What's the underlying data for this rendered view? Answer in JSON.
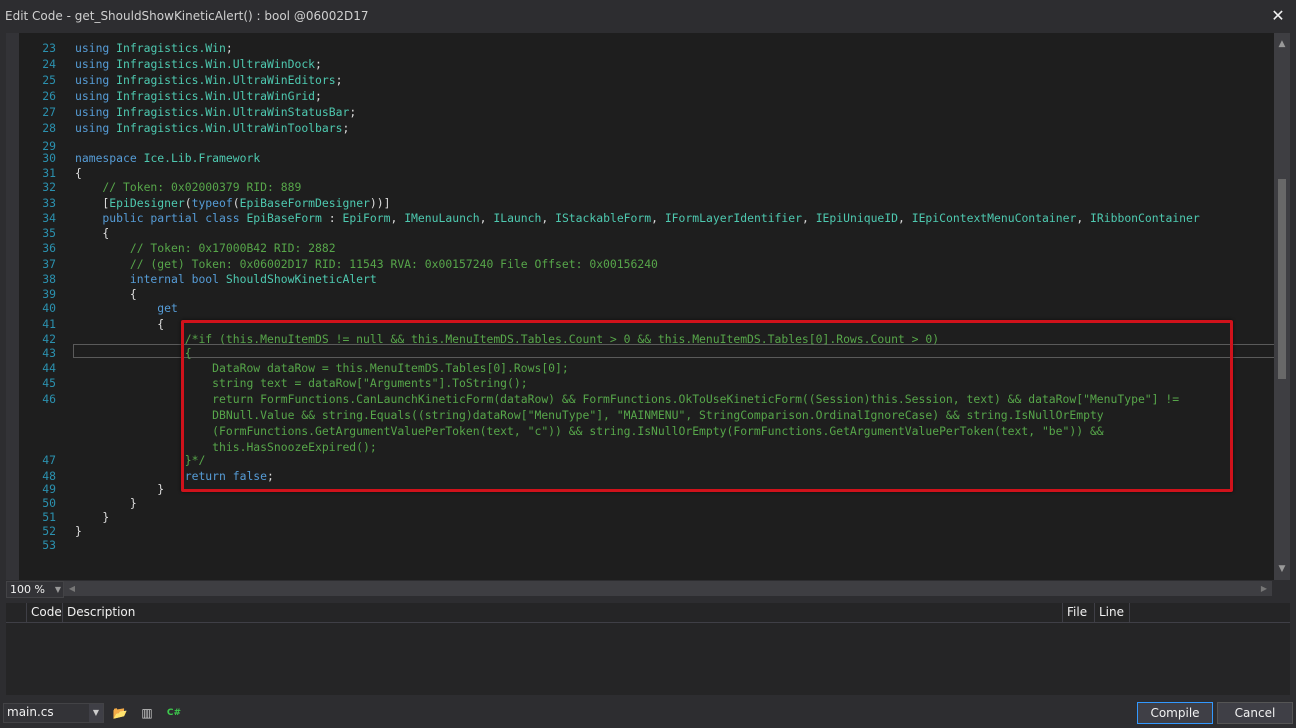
{
  "window": {
    "title": "Edit Code - get_ShouldShowKineticAlert() : bool @06002D17",
    "close_glyph": "✕"
  },
  "editor": {
    "lines": [
      {
        "n": "23",
        "segs": [
          [
            "kw",
            "using"
          ],
          [
            "nm",
            " "
          ],
          [
            "ty",
            "Infragistics.Win"
          ],
          [
            "nm",
            ";"
          ]
        ]
      },
      {
        "n": "24",
        "segs": [
          [
            "kw",
            "using"
          ],
          [
            "nm",
            " "
          ],
          [
            "ty",
            "Infragistics.Win.UltraWinDock"
          ],
          [
            "nm",
            ";"
          ]
        ]
      },
      {
        "n": "25",
        "segs": [
          [
            "kw",
            "using"
          ],
          [
            "nm",
            " "
          ],
          [
            "ty",
            "Infragistics.Win.UltraWinEditors"
          ],
          [
            "nm",
            ";"
          ]
        ]
      },
      {
        "n": "26",
        "segs": [
          [
            "kw",
            "using"
          ],
          [
            "nm",
            " "
          ],
          [
            "ty",
            "Infragistics.Win.UltraWinGrid"
          ],
          [
            "nm",
            ";"
          ]
        ]
      },
      {
        "n": "27",
        "segs": [
          [
            "kw",
            "using"
          ],
          [
            "nm",
            " "
          ],
          [
            "ty",
            "Infragistics.Win.UltraWinStatusBar"
          ],
          [
            "nm",
            ";"
          ]
        ]
      },
      {
        "n": "28",
        "segs": [
          [
            "kw",
            "using"
          ],
          [
            "nm",
            " "
          ],
          [
            "ty",
            "Infragistics.Win.UltraWinToolbars"
          ],
          [
            "nm",
            ";"
          ]
        ]
      },
      {
        "n": "29",
        "segs": []
      },
      {
        "n": "30",
        "segs": [
          [
            "kw",
            "namespace"
          ],
          [
            "nm",
            " "
          ],
          [
            "ty",
            "Ice.Lib.Framework"
          ]
        ]
      },
      {
        "n": "31",
        "segs": [
          [
            "nm",
            "{"
          ]
        ]
      },
      {
        "n": "32",
        "segs": [
          [
            "cm",
            "    // Token: 0x02000379 RID: 889"
          ]
        ]
      },
      {
        "n": "33",
        "segs": [
          [
            "nm",
            "    ["
          ],
          [
            "ty",
            "EpiDesigner"
          ],
          [
            "nm",
            "("
          ],
          [
            "kw",
            "typeof"
          ],
          [
            "nm",
            "("
          ],
          [
            "ty",
            "EpiBaseFormDesigner"
          ],
          [
            "nm",
            "))]"
          ]
        ]
      },
      {
        "n": "34",
        "segs": [
          [
            "kw",
            "    public partial class"
          ],
          [
            "nm",
            " "
          ],
          [
            "ty",
            "EpiBaseForm"
          ],
          [
            "nm",
            " : "
          ],
          [
            "ty",
            "EpiForm"
          ],
          [
            "nm",
            ", "
          ],
          [
            "ty",
            "IMenuLaunch"
          ],
          [
            "nm",
            ", "
          ],
          [
            "ty",
            "ILaunch"
          ],
          [
            "nm",
            ", "
          ],
          [
            "ty",
            "IStackableForm"
          ],
          [
            "nm",
            ", "
          ],
          [
            "ty",
            "IFormLayerIdentifier"
          ],
          [
            "nm",
            ", "
          ],
          [
            "ty",
            "IEpiUniqueID"
          ],
          [
            "nm",
            ", "
          ],
          [
            "ty",
            "IEpiContextMenuContainer"
          ],
          [
            "nm",
            ", "
          ],
          [
            "ty",
            "IRibbonContainer"
          ]
        ]
      },
      {
        "n": "35",
        "segs": [
          [
            "nm",
            "    {"
          ]
        ]
      },
      {
        "n": "36",
        "segs": [
          [
            "cm",
            "        // Token: 0x17000B42 RID: 2882"
          ]
        ]
      },
      {
        "n": "37",
        "segs": [
          [
            "cm",
            "        // (get) Token: 0x06002D17 RID: 11543 RVA: 0x00157240 File Offset: 0x00156240"
          ]
        ]
      },
      {
        "n": "38",
        "segs": [
          [
            "kw",
            "        internal bool"
          ],
          [
            "nm",
            " "
          ],
          [
            "ty",
            "ShouldShowKineticAlert"
          ]
        ]
      },
      {
        "n": "39",
        "segs": [
          [
            "nm",
            "        {"
          ]
        ]
      },
      {
        "n": "40",
        "segs": [
          [
            "kw",
            "            get"
          ]
        ]
      },
      {
        "n": "41",
        "segs": [
          [
            "nm",
            "            {"
          ]
        ]
      },
      {
        "n": "42",
        "segs": [
          [
            "cm",
            "                /*if (this.MenuItemDS != null && this.MenuItemDS.Tables.Count > 0 && this.MenuItemDS.Tables[0].Rows.Count > 0)"
          ]
        ]
      },
      {
        "n": "43",
        "segs": [
          [
            "cm",
            "                {"
          ]
        ]
      },
      {
        "n": "44",
        "segs": [
          [
            "cm",
            "                    DataRow dataRow = this.MenuItemDS.Tables[0].Rows[0];"
          ]
        ]
      },
      {
        "n": "45",
        "segs": [
          [
            "cm",
            "                    string text = dataRow[\"Arguments\"].ToString();"
          ]
        ]
      },
      {
        "n": "46",
        "segs": [
          [
            "cm",
            "                    return FormFunctions.CanLaunchKineticForm(dataRow) && FormFunctions.OkToUseKineticForm((Session)this.Session, text) && dataRow[\"MenuType\"] !="
          ]
        ]
      },
      {
        "n": "",
        "segs": [
          [
            "cm",
            "                    DBNull.Value && string.Equals((string)dataRow[\"MenuType\"], \"MAINMENU\", StringComparison.OrdinalIgnoreCase) && string.IsNullOrEmpty"
          ]
        ]
      },
      {
        "n": "",
        "segs": [
          [
            "cm",
            "                    (FormFunctions.GetArgumentValuePerToken(text, \"c\")) && string.IsNullOrEmpty(FormFunctions.GetArgumentValuePerToken(text, \"be\")) &&"
          ]
        ]
      },
      {
        "n": "",
        "segs": [
          [
            "cm",
            "                    this.HasSnoozeExpired();"
          ]
        ]
      },
      {
        "n": "47",
        "segs": [
          [
            "cm",
            "                }*/"
          ]
        ]
      },
      {
        "n": "48",
        "segs": [
          [
            "kw",
            "                return false"
          ],
          [
            "nm",
            ";"
          ]
        ]
      },
      {
        "n": "49",
        "segs": [
          [
            "nm",
            "            }"
          ]
        ]
      },
      {
        "n": "50",
        "segs": [
          [
            "nm",
            "        }"
          ]
        ]
      },
      {
        "n": "51",
        "segs": [
          [
            "nm",
            "    }"
          ]
        ]
      },
      {
        "n": "52",
        "segs": [
          [
            "nm",
            "}"
          ]
        ]
      },
      {
        "n": "53",
        "segs": []
      }
    ],
    "zoom": "100 %",
    "scroll_arrows": {
      "up": "▲",
      "down": "▼",
      "left": "◀",
      "right": "▶",
      "dropdown": "▼"
    }
  },
  "error_list": {
    "columns": {
      "code": "Code",
      "description": "Description",
      "file": "File",
      "line": "Line"
    }
  },
  "footer": {
    "file_selected": "main.cs",
    "icons": {
      "open": "📂",
      "references": "▥",
      "csharp": "C#"
    },
    "compile_label": "Compile",
    "cancel_label": "Cancel"
  },
  "colors": {
    "keyword": "#569cd6",
    "type": "#4ec9b0",
    "comment": "#57a64a",
    "highlight_border": "#d0121b"
  }
}
